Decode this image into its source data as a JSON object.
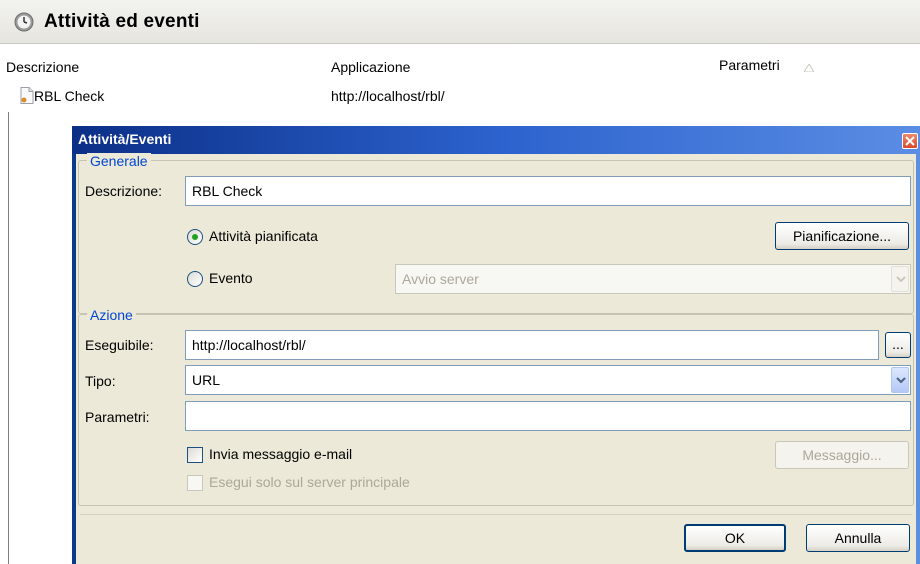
{
  "panel": {
    "title": "Attività ed eventi",
    "columns": [
      "Descrizione",
      "Applicazione",
      "Parametri"
    ],
    "rows": [
      {
        "descrizione": "RBL Check",
        "applicazione": "http://localhost/rbl/"
      }
    ]
  },
  "dialog": {
    "title": "Attività/Eventi",
    "generale": {
      "legend": "Generale",
      "descrizione_label": "Descrizione:",
      "descrizione_value": "RBL Check",
      "radio_attivita": "Attività pianificata",
      "radio_attivita_checked": true,
      "pianificazione_button": "Pianificazione...",
      "radio_evento": "Evento",
      "evento_value": "Avvio server"
    },
    "azione": {
      "legend": "Azione",
      "eseguibile_label": "Eseguibile:",
      "eseguibile_value": "http://localhost/rbl/",
      "browse_button": "...",
      "tipo_label": "Tipo:",
      "tipo_value": "URL",
      "parametri_label": "Parametri:",
      "parametri_value": "",
      "invia_email_label": "Invia messaggio e-mail",
      "messaggio_button": "Messaggio...",
      "esegui_solo_label": "Esegui solo sul server principale"
    },
    "ok_button": "OK",
    "annulla_button": "Annulla"
  },
  "colors": {
    "titlebar_start": "#0b2f87",
    "titlebar_end": "#5b8de4",
    "dialog_bg": "#ece9d8",
    "legend_text": "#0046d5",
    "radio_dot": "#21a121"
  },
  "icons": [
    "clock-icon",
    "sort-arrow-icon",
    "file-icon",
    "close-icon",
    "chevron-down-icon"
  ]
}
